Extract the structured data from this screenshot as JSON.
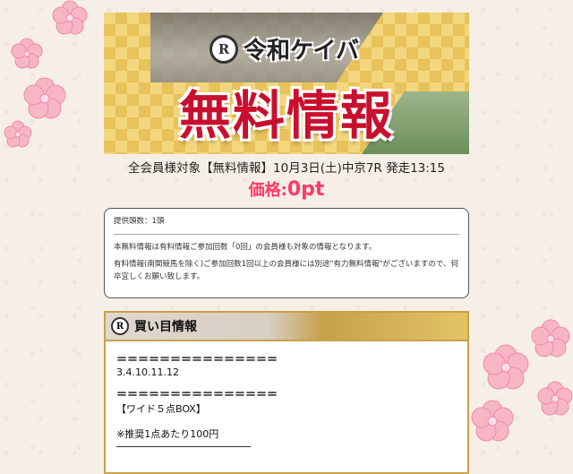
{
  "banner": {
    "brand_logo": "R",
    "brand_name": "令和ケイバ",
    "title": "無料情報"
  },
  "subtitle": "全会員様対象【無料情報】10月3日(土)中京7R 発走13:15",
  "price": {
    "label": "価格:",
    "value": "0pt"
  },
  "notice": {
    "count": "提供頭数：1頭",
    "line1": "本無料情報は有料情報ご参加回数「0回」の会員様も対象の情報となります。",
    "line2": "有料情報(南関競馬を除く)ご参加回数1回以上の会員様には別途\"有力無料情報\"がございますので、何卒宜しくお願い致します。"
  },
  "buy": {
    "header_logo": "R",
    "header": "買い目情報",
    "sep1": "＝＝＝＝＝＝＝＝＝＝＝＝＝＝＝",
    "numbers": "3.4.10.11.12",
    "sep2": "＝＝＝＝＝＝＝＝＝＝＝＝＝＝＝",
    "bet_type": "【ワイド５点BOX】",
    "recommend": "※推奨1点あたり100円"
  },
  "colors": {
    "accent": "#c8102e",
    "price": "#ff3a63",
    "gold": "#c9a14a",
    "blossom": "#f4a3b8"
  }
}
